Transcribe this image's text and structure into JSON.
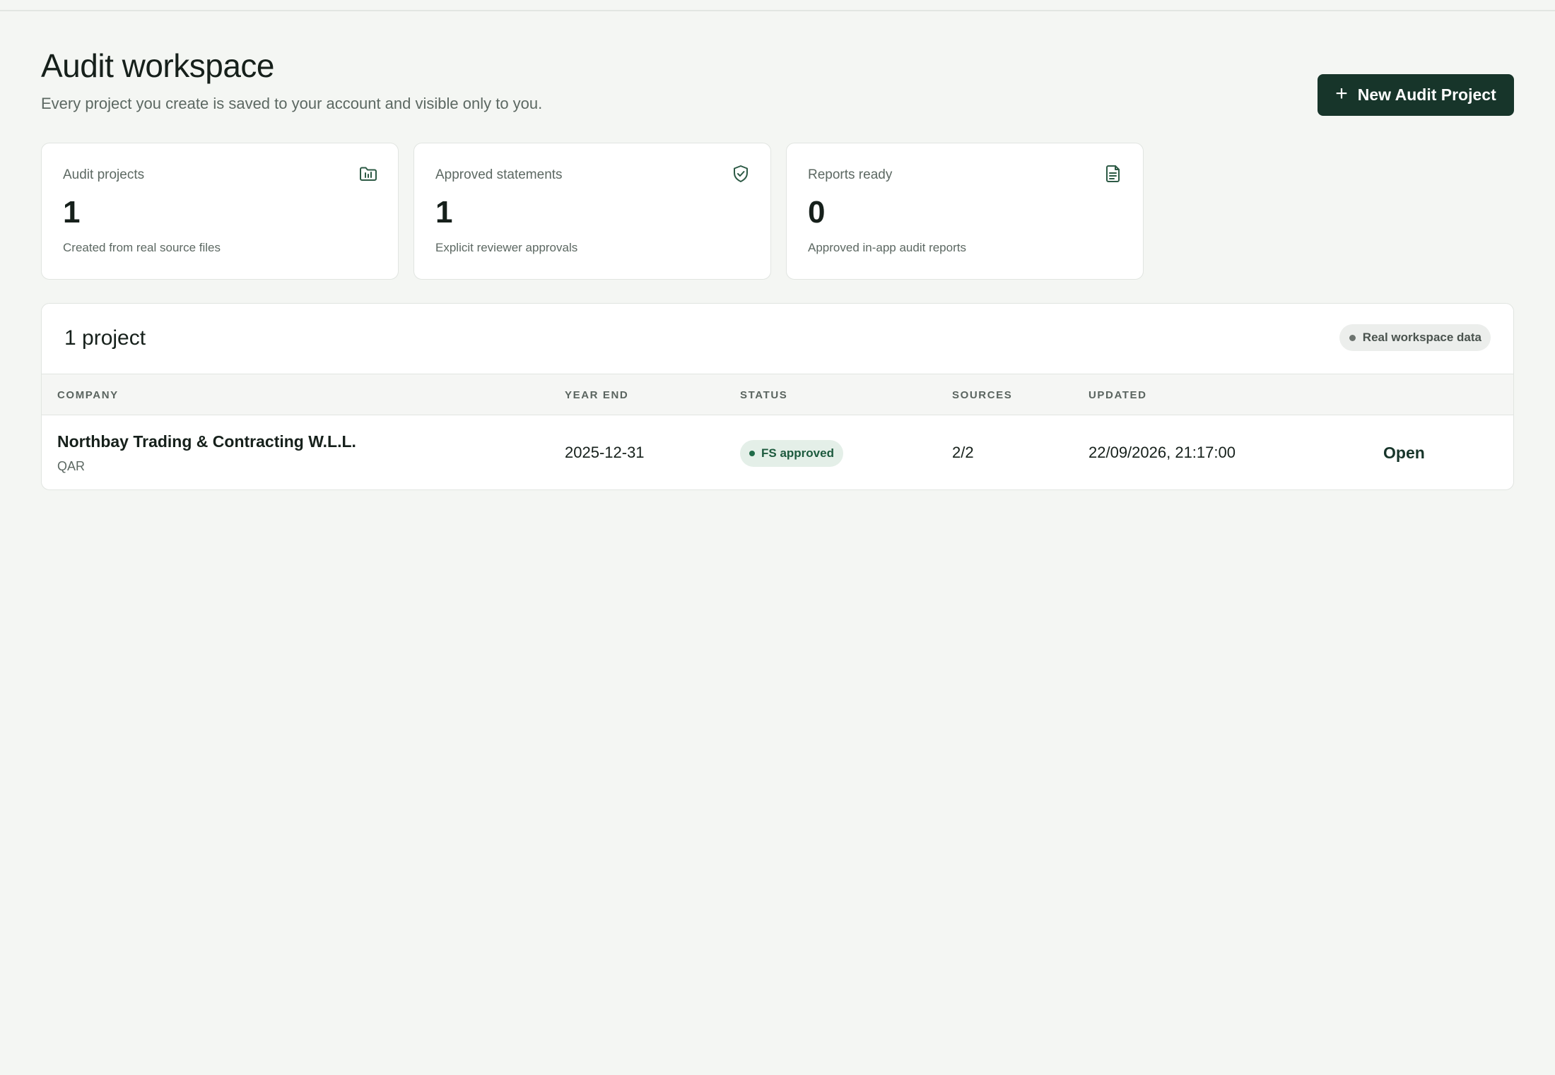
{
  "header": {
    "title": "Audit workspace",
    "subtitle": "Every project you create is saved to your account and visible only to you.",
    "new_button_label": "New Audit Project"
  },
  "stats": [
    {
      "label": "Audit projects",
      "value": "1",
      "description": "Created from real source files",
      "icon": "folder-chart-icon"
    },
    {
      "label": "Approved statements",
      "value": "1",
      "description": "Explicit reviewer approvals",
      "icon": "shield-check-icon"
    },
    {
      "label": "Reports ready",
      "value": "0",
      "description": "Approved in-app audit reports",
      "icon": "document-icon"
    }
  ],
  "projects_panel": {
    "title": "1 project",
    "badge": "Real workspace data",
    "columns": [
      "COMPANY",
      "YEAR END",
      "STATUS",
      "SOURCES",
      "UPDATED"
    ],
    "rows": [
      {
        "company": "Northbay Trading & Contracting W.L.L.",
        "currency": "QAR",
        "year_end": "2025-12-31",
        "status": "FS approved",
        "sources": "2/2",
        "updated": "22/09/2026, 21:17:00",
        "action": "Open"
      }
    ]
  },
  "colors": {
    "accent": "#17352a",
    "background": "#f4f6f3",
    "status_approved_bg": "#e4efe8",
    "status_approved_text": "#1d5a3e"
  }
}
